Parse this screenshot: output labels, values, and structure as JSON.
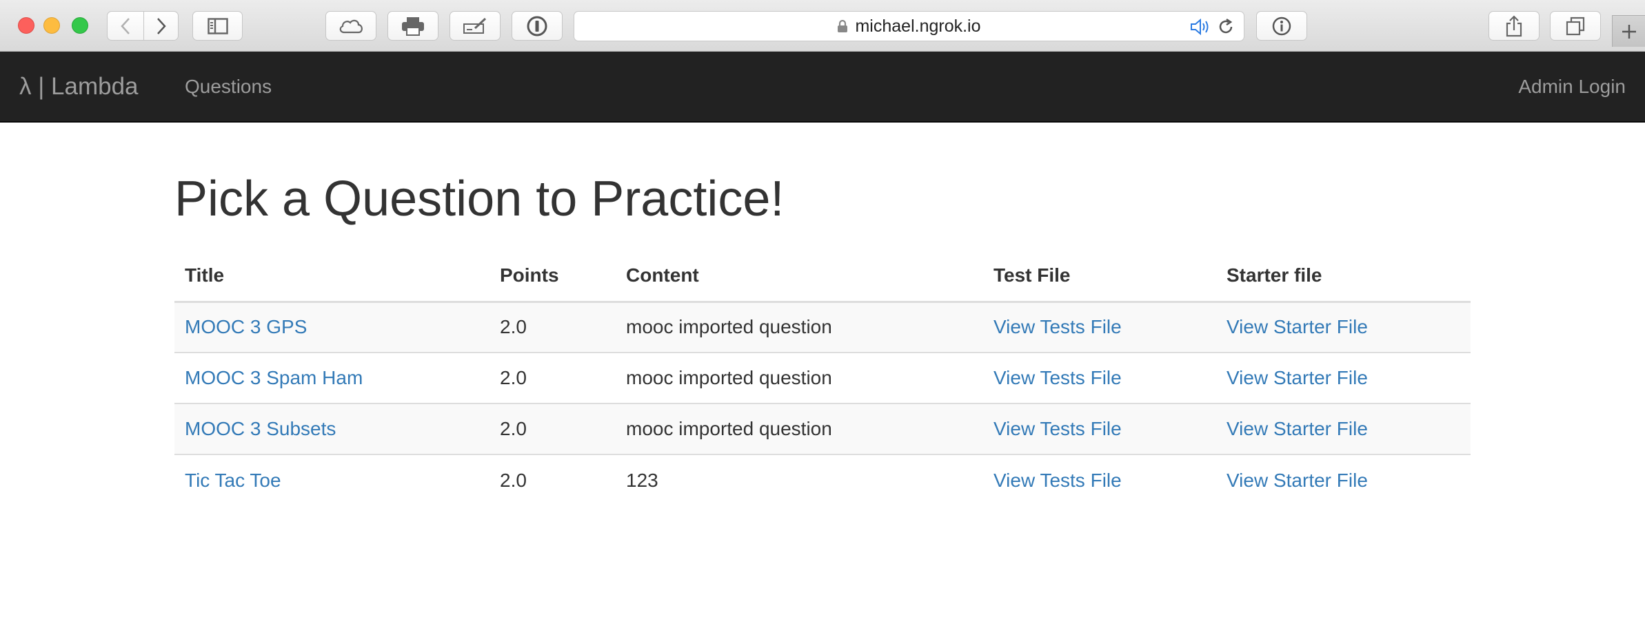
{
  "browser": {
    "url": "michael.ngrok.io"
  },
  "navbar": {
    "brand": "λ | Lambda",
    "questions_label": "Questions",
    "admin_label": "Admin Login"
  },
  "page": {
    "title": "Pick a Question to Practice!"
  },
  "table": {
    "headers": {
      "title": "Title",
      "points": "Points",
      "content": "Content",
      "test_file": "Test File",
      "starter_file": "Starter file"
    },
    "rows": [
      {
        "title": "MOOC 3 GPS",
        "points": "2.0",
        "content": "mooc imported question",
        "test_link": "View Tests File",
        "starter_link": "View Starter File"
      },
      {
        "title": "MOOC 3 Spam Ham",
        "points": "2.0",
        "content": "mooc imported question",
        "test_link": "View Tests File",
        "starter_link": "View Starter File"
      },
      {
        "title": "MOOC 3 Subsets",
        "points": "2.0",
        "content": "mooc imported question",
        "test_link": "View Tests File",
        "starter_link": "View Starter File"
      },
      {
        "title": "Tic Tac Toe",
        "points": "2.0",
        "content": "123",
        "test_link": "View Tests File",
        "starter_link": "View Starter File"
      }
    ]
  },
  "colors": {
    "navbar_bg": "#222222",
    "link": "#337ab7",
    "nav_text": "#9d9d9d"
  }
}
